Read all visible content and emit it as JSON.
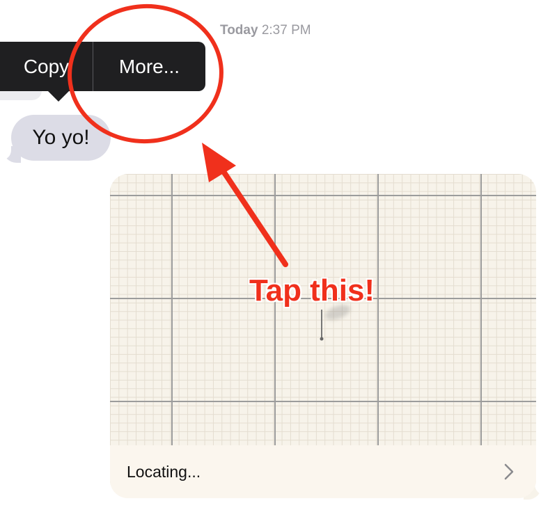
{
  "conversation": {
    "timestamp": {
      "day": "Today",
      "time": "2:37 PM"
    }
  },
  "context_menu": {
    "copy_label": "Copy",
    "more_label": "More..."
  },
  "incoming_message": {
    "text": "Yo yo!"
  },
  "location_message": {
    "status": "Locating...",
    "chevron_icon": "chevron-right-icon",
    "pin_icon": "map-pin-icon"
  },
  "annotation": {
    "text": "Tap this!",
    "color": "#f0301c"
  }
}
